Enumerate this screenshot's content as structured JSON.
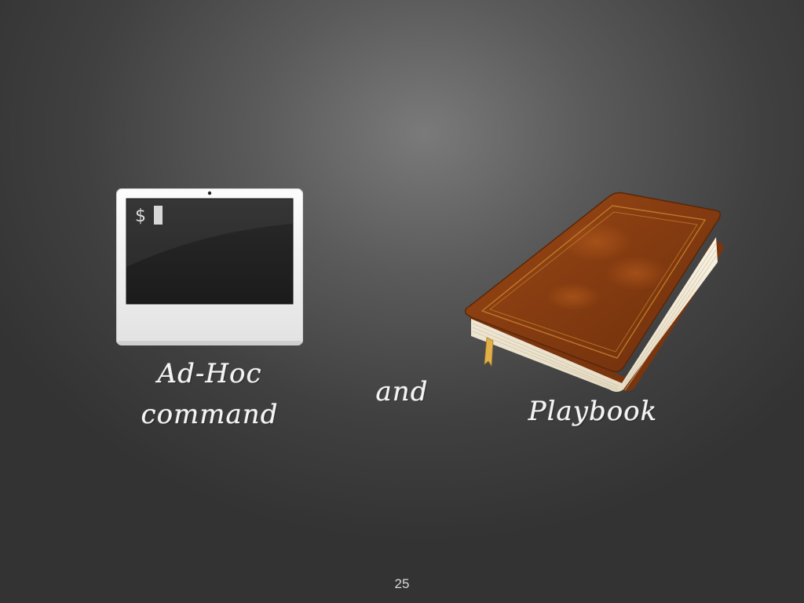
{
  "terminal": {
    "prompt": "$"
  },
  "labels": {
    "adhoc_line1": "Ad-Hoc",
    "adhoc_line2": "command",
    "and": "and",
    "playbook": "Playbook"
  },
  "page_number": "25",
  "icons": [
    "terminal-icon",
    "book-icon"
  ],
  "colors": {
    "background_light": "#7a7a7a",
    "background_dark": "#333333",
    "book_cover": "#8a3f12",
    "chalk_text": "#f4f4f4"
  }
}
